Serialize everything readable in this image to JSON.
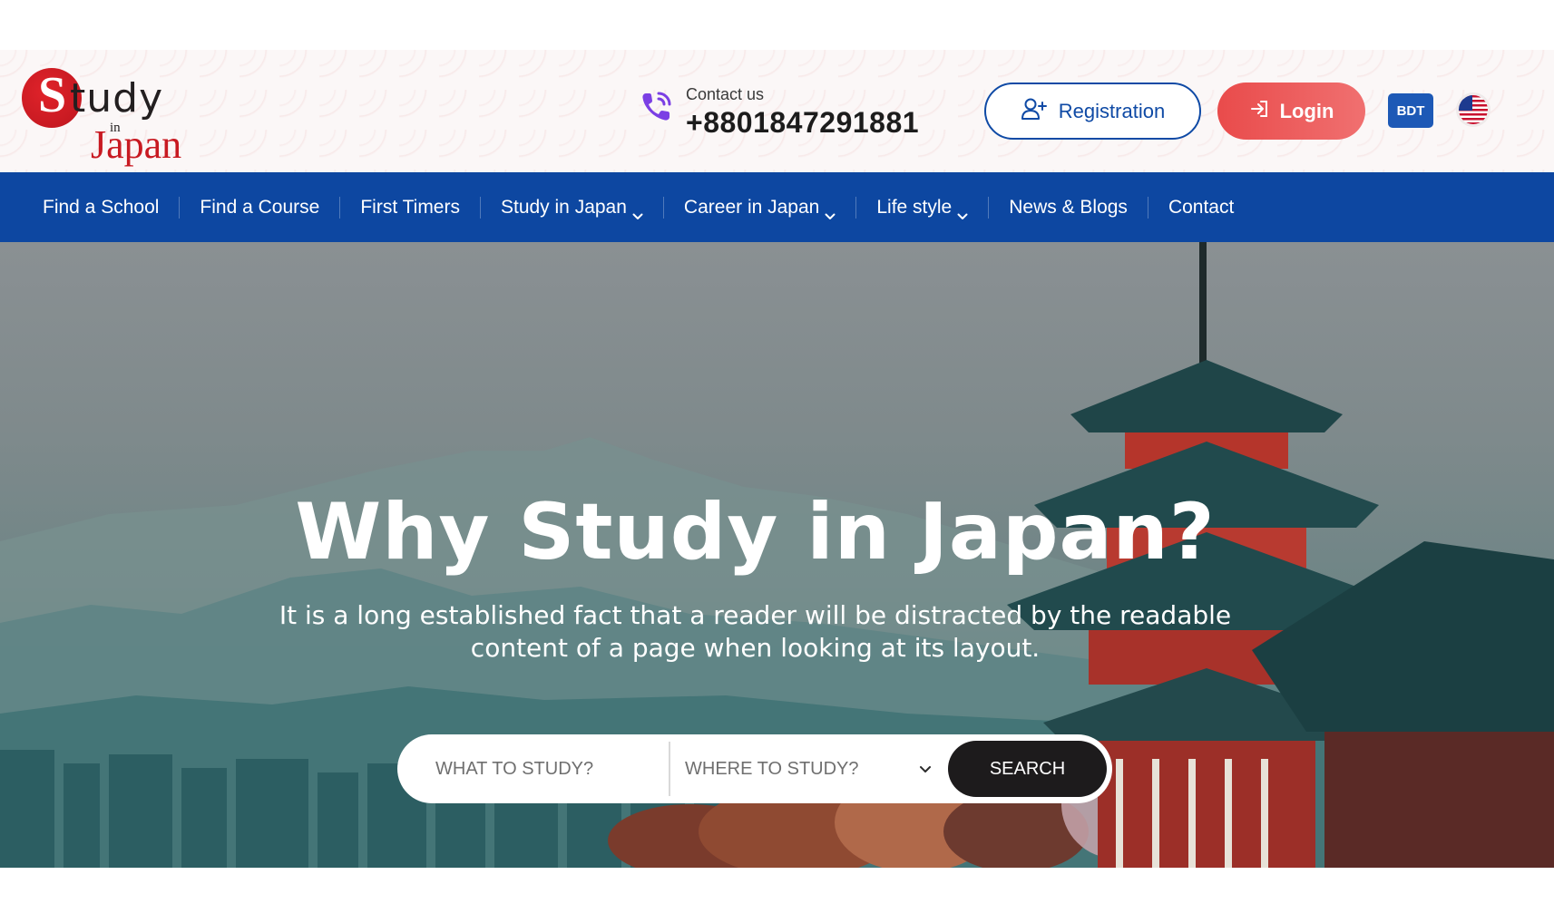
{
  "header": {
    "logo": {
      "top": "Study",
      "middle": "in",
      "bottom": "Japan"
    },
    "contact": {
      "label": "Contact us",
      "phone": "+8801847291881"
    },
    "register_label": "Registration",
    "login_label": "Login",
    "currency": "BDT",
    "language_flag": "us-flag-icon"
  },
  "nav": {
    "items": [
      {
        "label": "Find a School",
        "dropdown": false
      },
      {
        "label": "Find a Course",
        "dropdown": false
      },
      {
        "label": "First Timers",
        "dropdown": false
      },
      {
        "label": "Study in Japan",
        "dropdown": true
      },
      {
        "label": "Career in Japan",
        "dropdown": true
      },
      {
        "label": "Life style",
        "dropdown": true
      },
      {
        "label": "News & Blogs",
        "dropdown": false
      },
      {
        "label": "Contact",
        "dropdown": false
      }
    ]
  },
  "hero": {
    "title": "Why Study in Japan?",
    "subtitle": "It is a long established fact that a reader will be distracted by the readable content of a page when looking at its layout.",
    "search": {
      "what_placeholder": "WHAT TO STUDY?",
      "where_placeholder": "WHERE TO STUDY?",
      "button_label": "SEARCH"
    }
  },
  "colors": {
    "brand_red": "#c81a22",
    "nav_blue": "#0d47a1",
    "login_red": "#e94b4b",
    "currency_blue": "#1d59b6"
  }
}
